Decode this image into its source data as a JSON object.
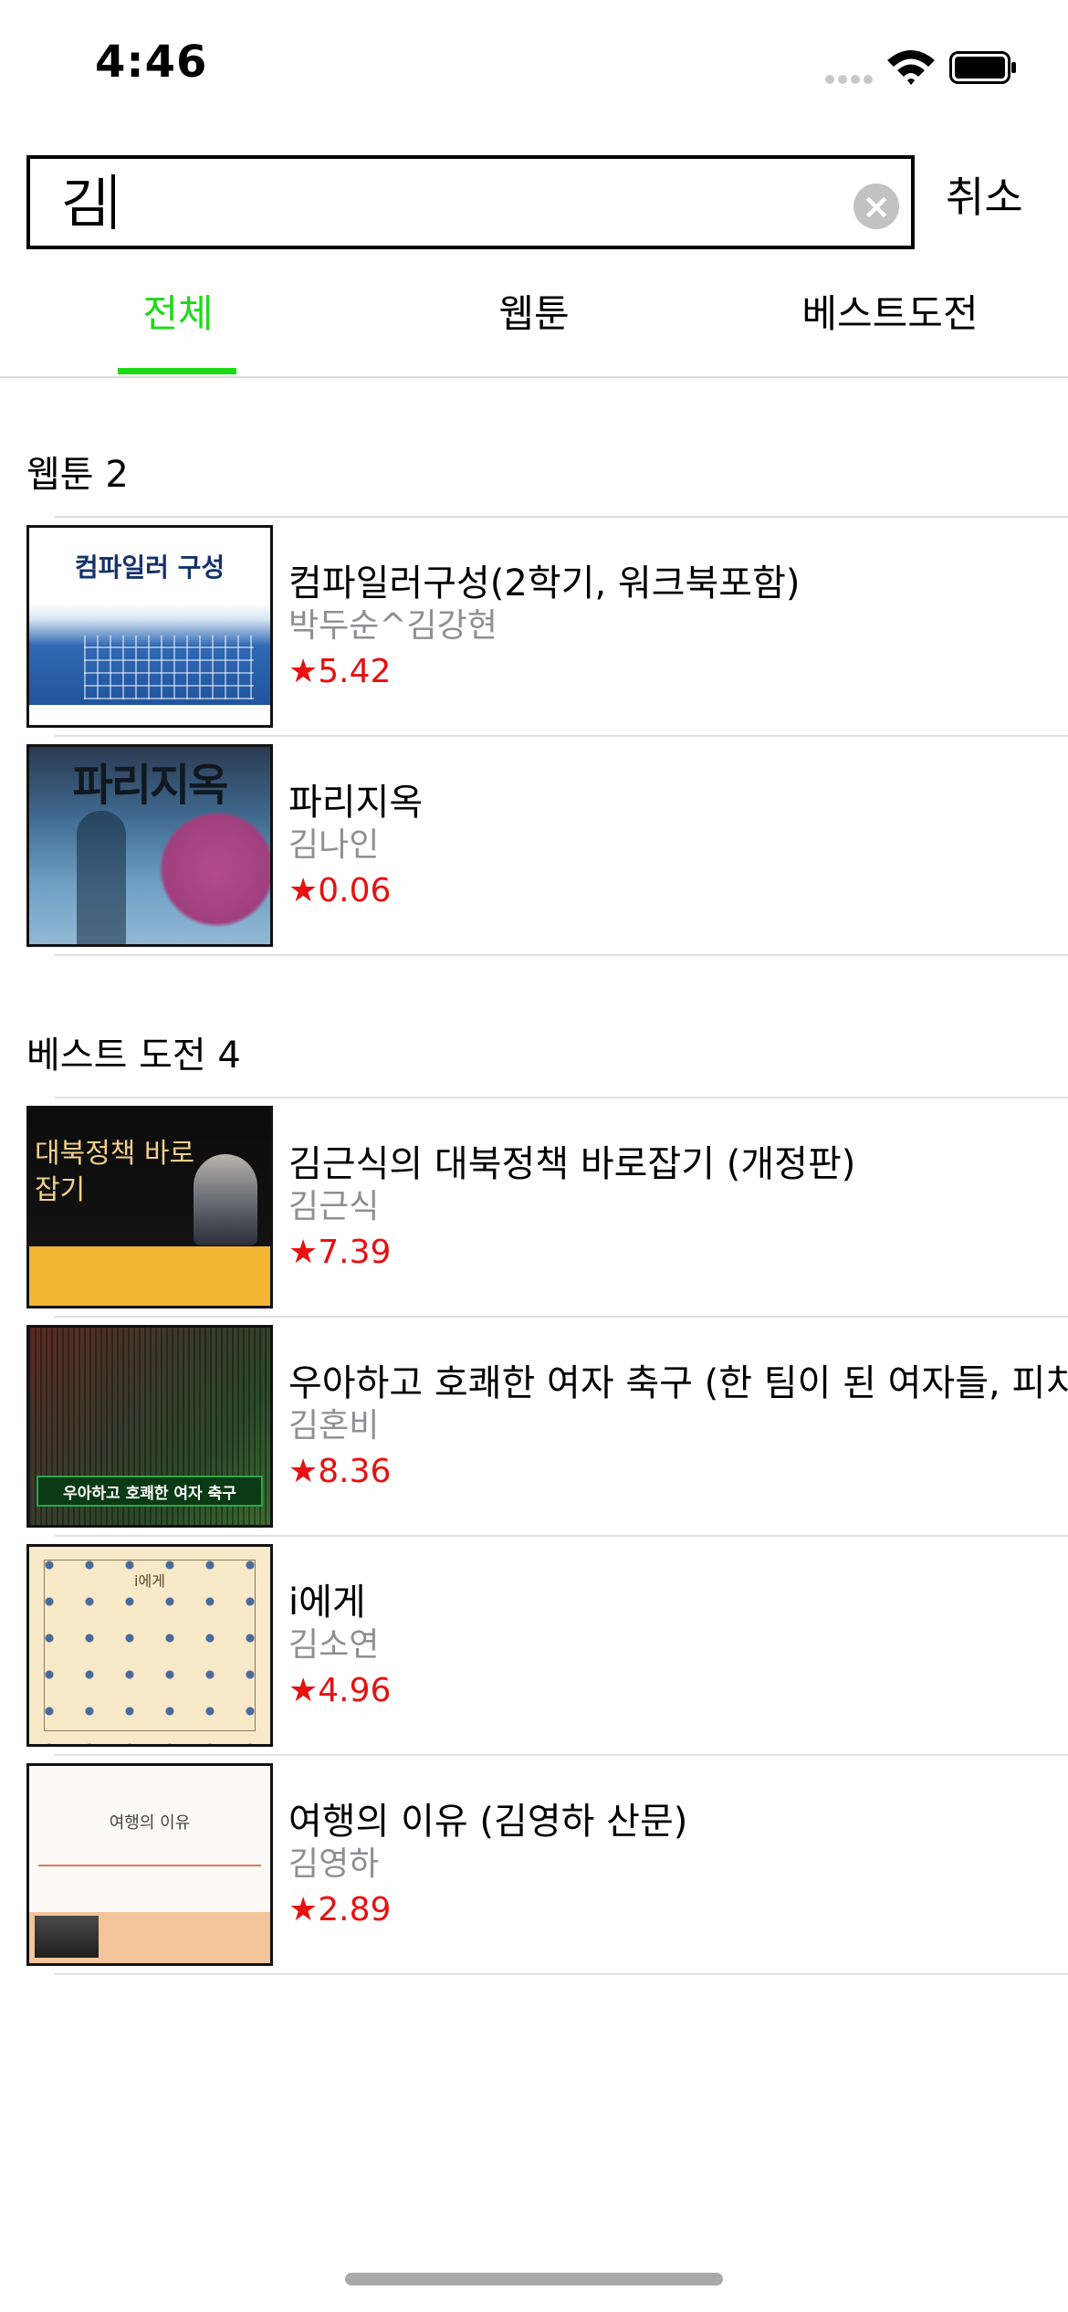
{
  "status_bar": {
    "time": "4:46"
  },
  "search": {
    "value": "김",
    "cancel_label": "취소"
  },
  "tabs": [
    {
      "label": "전체",
      "active": true
    },
    {
      "label": "웹툰",
      "active": false
    },
    {
      "label": "베스트도전",
      "active": false
    }
  ],
  "sections": {
    "webtoon": {
      "header": "웹툰 2",
      "items": [
        {
          "title": "컴파일러구성(2학기, 워크북포함)",
          "author": "박두순^김강현",
          "rating": "★5.42",
          "cover_text": "컴파일러 구성"
        },
        {
          "title": "파리지옥",
          "author": "김나인",
          "rating": "★0.06",
          "cover_text": "파리지옥"
        }
      ]
    },
    "best_challenge": {
      "header": "베스트 도전 4",
      "items": [
        {
          "title": "김근식의 대북정책 바로잡기 (개정판)",
          "author": "김근식",
          "rating": "★7.39",
          "cover_text": "대북정책 바로잡기"
        },
        {
          "title": "우아하고 호쾌한 여자 축구 (한 팀이 된 여자들, 피치에",
          "author": "김혼비",
          "rating": "★8.36",
          "cover_text": "우아하고 호쾌한 여자 축구"
        },
        {
          "title": "i에게",
          "author": "김소연",
          "rating": "★4.96",
          "cover_text": "i에게"
        },
        {
          "title": "여행의 이유 (김영하 산문)",
          "author": "김영하",
          "rating": "★2.89",
          "cover_text": "여행의 이유"
        }
      ]
    }
  },
  "colors": {
    "accent": "#1ddb16",
    "rating": "#e81010",
    "secondary_text": "#8e8e93"
  }
}
